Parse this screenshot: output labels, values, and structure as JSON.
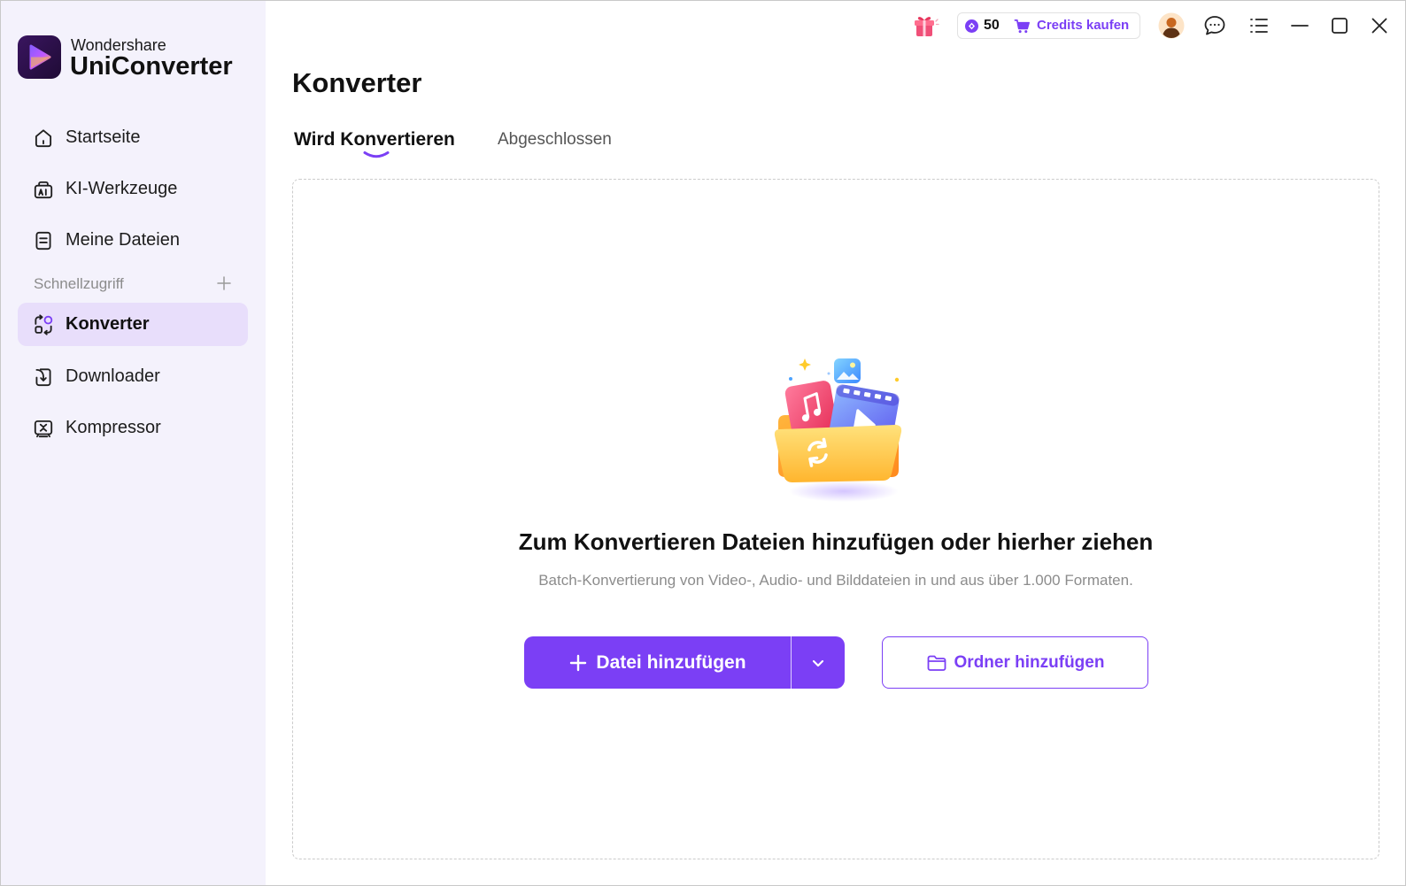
{
  "app": {
    "brand": "Wondershare",
    "product": "UniConverter",
    "logo_icon": "uniconverter-logo-icon"
  },
  "header": {
    "credits": "50",
    "buy_credits_label": "Credits kaufen",
    "icons": [
      "gift-icon",
      "credits-diamond-icon",
      "cart-icon",
      "avatar",
      "chat-icon",
      "menu-list-icon",
      "minimize-icon",
      "maximize-icon",
      "close-icon"
    ]
  },
  "sidebar": {
    "nav": [
      {
        "label": "Startseite",
        "icon": "home-icon",
        "active": false
      },
      {
        "label": "KI-Werkzeuge",
        "icon": "ai-tools-icon",
        "active": false
      },
      {
        "label": "Meine Dateien",
        "icon": "files-icon",
        "active": false
      }
    ],
    "quick_access": {
      "label": "Schnellzugriff",
      "add_icon": "plus-icon",
      "items": [
        {
          "label": "Konverter",
          "icon": "converter-icon",
          "active": true
        },
        {
          "label": "Downloader",
          "icon": "downloader-icon",
          "active": false
        },
        {
          "label": "Kompressor",
          "icon": "compressor-icon",
          "active": false
        }
      ]
    }
  },
  "page": {
    "title": "Konverter",
    "tabs": [
      {
        "label": "Wird Konvertieren",
        "active": true
      },
      {
        "label": "Abgeschlossen",
        "active": false
      }
    ]
  },
  "dropzone": {
    "illustration": "media-folder-illustration",
    "heading": "Zum Konvertieren Dateien hinzufügen oder hierher ziehen",
    "description": "Batch-Konvertierung von Video-, Audio- und Bilddateien in und aus über 1.000 Formaten.",
    "add_file_label": "Datei hinzufügen",
    "add_folder_label": "Ordner hinzufügen"
  },
  "colors": {
    "accent": "#7b3ff5",
    "sidebar_bg": "#f4f2fc",
    "active_bg": "#e8defb",
    "text": "#141414",
    "muted_text": "#8c8c8c",
    "dropzone_border": "#cbcbcb"
  }
}
